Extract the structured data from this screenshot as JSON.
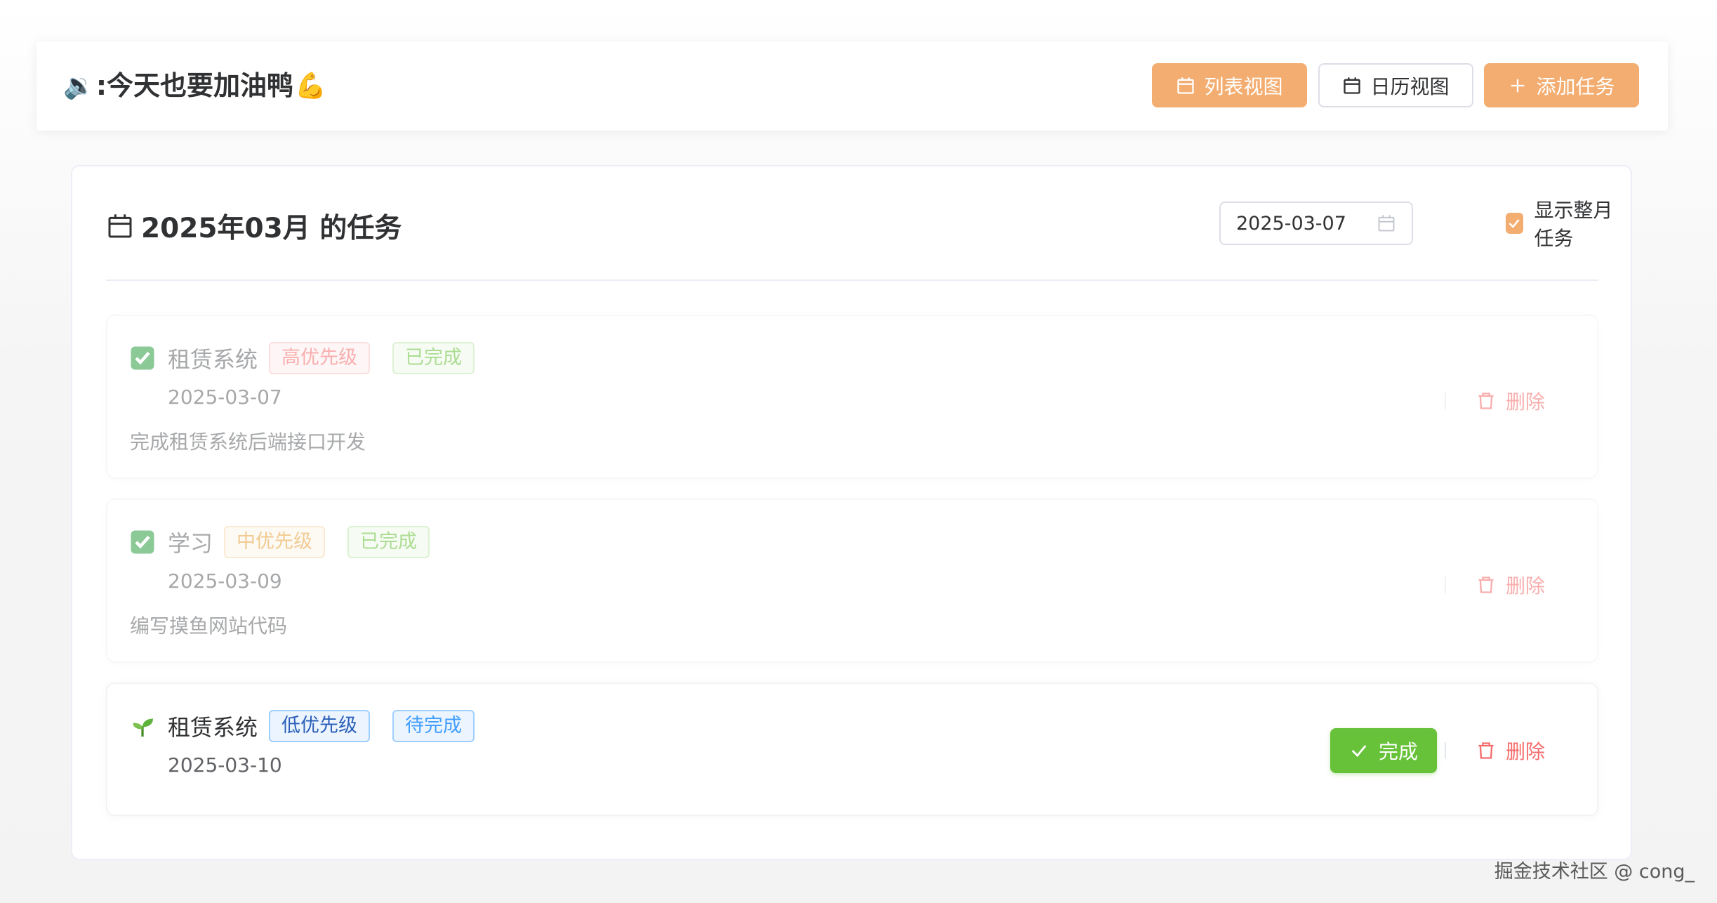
{
  "header": {
    "icon": "🔉",
    "title": ":今天也要加油鸭",
    "title_emoji": "💪",
    "list_view_label": "列表视图",
    "calendar_view_label": "日历视图",
    "add_task_label": "添加任务"
  },
  "main": {
    "title": "2025年03月 的任务",
    "date_value": "2025-03-07",
    "show_month_label": "显示整月任务",
    "show_month_checked": true
  },
  "tasks": [
    {
      "status_icon": "check-box",
      "name": "租赁系统",
      "priority": "高优先级",
      "status": "已完成",
      "date": "2025-03-07",
      "description": "完成租赁系统后端接口开发",
      "delete_label": "删除"
    },
    {
      "status_icon": "check-box",
      "name": "学习",
      "priority": "中优先级",
      "status": "已完成",
      "date": "2025-03-09",
      "description": "编写摸鱼网站代码",
      "delete_label": "删除"
    },
    {
      "status_icon": "seedling",
      "name": "租赁系统",
      "priority": "低优先级",
      "status": "待完成",
      "date": "2025-03-10",
      "complete_label": "完成",
      "delete_label": "删除"
    }
  ],
  "watermark": "掘金技术社区 @ cong_",
  "colors": {
    "accent": "#f3ad70",
    "success": "#67c23a",
    "danger": "#f56c6c"
  }
}
